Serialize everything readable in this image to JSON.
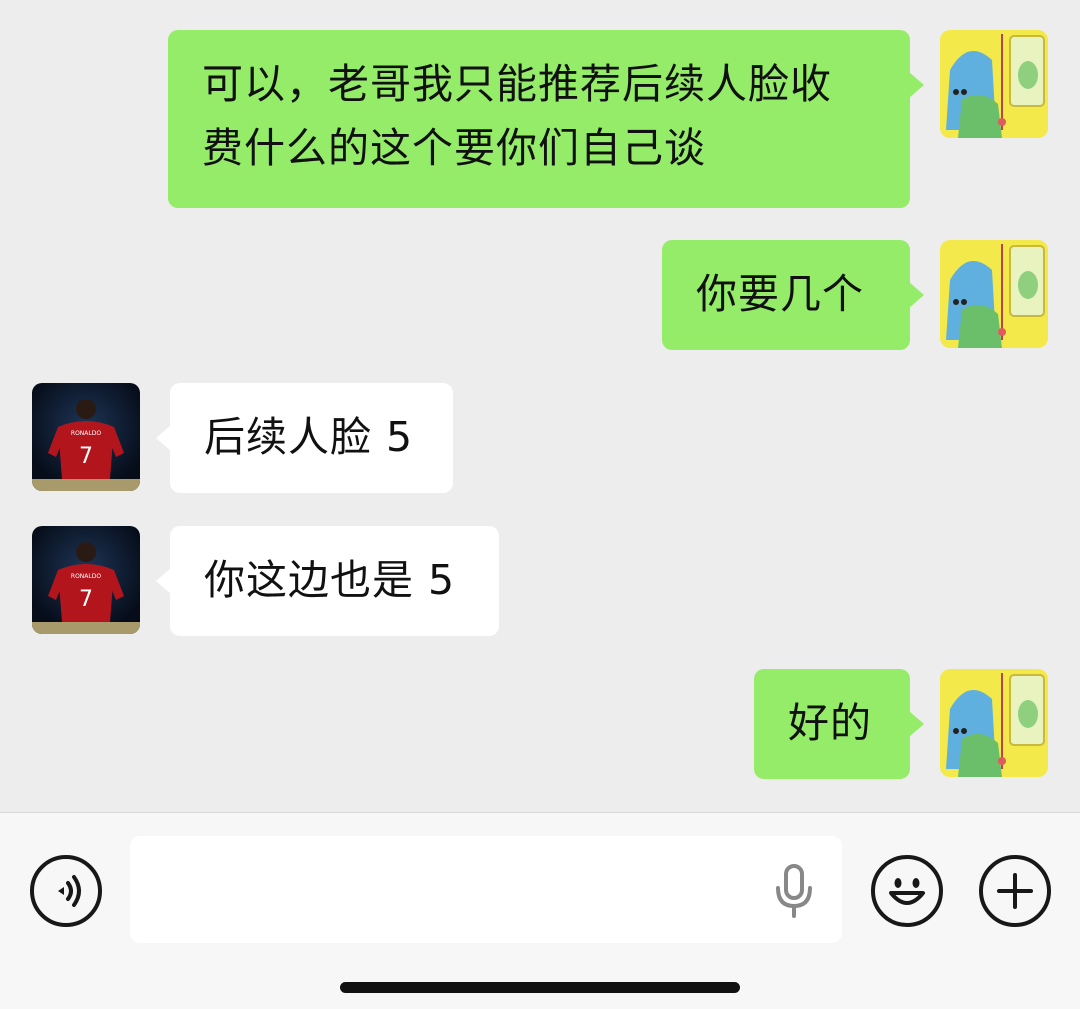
{
  "messages": [
    {
      "sender": "me",
      "text": "可以，老哥我只能推荐后续人脸收费什么的这个要你们自己谈",
      "line1": "可以，老哥我只能推荐后续人脸收",
      "line2": "费什么的这个要你们自己谈"
    },
    {
      "sender": "me",
      "text": "你要几个"
    },
    {
      "sender": "them",
      "text": "后续人脸 5"
    },
    {
      "sender": "them",
      "text": "你这边也是 5"
    },
    {
      "sender": "me",
      "text": "好的"
    }
  ],
  "avatars": {
    "me": {
      "icon": "cartoon-ghost-avatar",
      "colors": {
        "bg": "#f4e94a",
        "cloak": "#5fb0de",
        "figure": "#6bbf6a"
      }
    },
    "them": {
      "icon": "soccer-player-avatar",
      "jersey_text": "RONALDO",
      "jersey_number": "7",
      "colors": {
        "bg": "#0d1a2e",
        "jersey": "#b3151d"
      }
    }
  },
  "input_bar": {
    "voice_icon": "voice-mode-icon",
    "mic_icon": "microphone-icon",
    "emoji_icon": "emoji-icon",
    "plus_icon": "plus-icon"
  },
  "colors": {
    "my_bubble": "#95ec69",
    "their_bubble": "#ffffff",
    "chat_bg": "#ededed"
  }
}
